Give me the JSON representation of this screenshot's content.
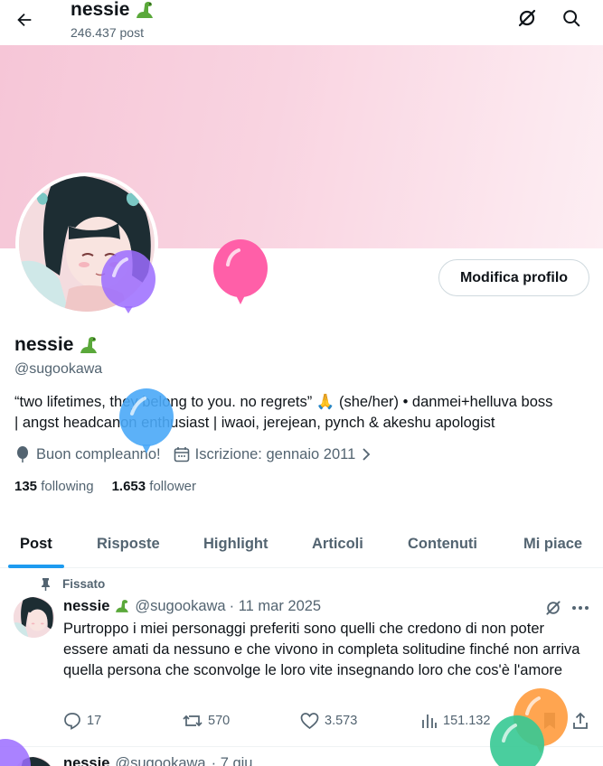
{
  "header": {
    "title": "nessie",
    "post_count": "246.437 post"
  },
  "profile": {
    "display_name": "nessie",
    "handle": "@sugookawa",
    "bio_line1": "“two lifetimes, they belong to you. no regrets” 🙏 (she/her) • danmei+helluva boss",
    "bio_line2": "| angst headcanon enthusiast | iwaoi, jerejean, pynch & akeshu apologist",
    "birthday": "Buon compleanno!",
    "joined": "Iscrizione: gennaio 2011",
    "following_count": "135",
    "following_label": "following",
    "follower_count": "1.653",
    "follower_label": "follower",
    "edit_button": "Modifica profilo"
  },
  "tabs": [
    "Post",
    "Risposte",
    "Highlight",
    "Articoli",
    "Contenuti",
    "Mi piace"
  ],
  "active_tab": "Post",
  "pinned_post": {
    "pinned_label": "Fissato",
    "name": "nessie",
    "handle": "@sugookawa",
    "date": "· 11 mar 2025",
    "text": "Purtroppo i miei personaggi preferiti sono quelli che credono di non poter essere amati da nessuno e che vivono in completa solitudine finché non arriva quella persona che sconvolge le loro vite insegnando loro che cos'è l'amore",
    "replies": "17",
    "reposts": "570",
    "likes": "3.573",
    "views": "151.132"
  },
  "next_post": {
    "name": "nessie",
    "handle": "@sugookawa",
    "date": "· 7 giu"
  },
  "colors": {
    "accent": "#1d9bf0",
    "text": "#0f1419",
    "muted": "#536471",
    "banner": "#f6c6d7",
    "balloon_pink": "#ff5fa8",
    "balloon_purple": "#9b6cff",
    "balloon_blue": "#4aa8f7",
    "balloon_orange": "#ff9b3d",
    "balloon_green": "#36c993"
  },
  "icons": [
    "back-arrow-icon",
    "grok-icon",
    "search-icon",
    "dinosaur-emoji",
    "balloon-icon",
    "calendar-icon",
    "chevron-right-icon",
    "pin-icon",
    "more-icon",
    "reply-icon",
    "repost-icon",
    "like-icon",
    "views-icon",
    "bookmark-icon",
    "share-icon"
  ]
}
